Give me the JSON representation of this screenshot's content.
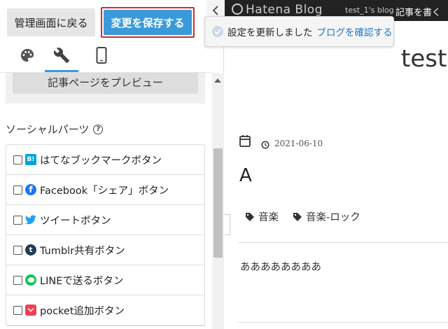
{
  "header": {
    "back_label": "管理画面に戻る",
    "save_label": "変更を保存する"
  },
  "tabs": [
    {
      "icon": "palette-icon"
    },
    {
      "icon": "wrench-icon"
    },
    {
      "icon": "smartphone-icon"
    }
  ],
  "preview_button_label": "記事ページをプレビュー",
  "social": {
    "heading": "ソーシャルパーツ",
    "help_glyph": "?",
    "items": [
      {
        "label": "はてなブックマークボタン",
        "icon": "hatena-bookmark-icon",
        "glyph": "B!",
        "checked": false
      },
      {
        "label": "Facebook「シェア」ボタン",
        "icon": "facebook-icon",
        "glyph": "f",
        "checked": false
      },
      {
        "label": "ツイートボタン",
        "icon": "twitter-icon",
        "glyph": "",
        "checked": false
      },
      {
        "label": "Tumblr共有ボタン",
        "icon": "tumblr-icon",
        "glyph": "t",
        "checked": false
      },
      {
        "label": "LINEで送るボタン",
        "icon": "line-icon",
        "glyph": "",
        "checked": false
      },
      {
        "label": "pocket追加ボタン",
        "icon": "pocket-icon",
        "glyph": "",
        "checked": false
      }
    ]
  },
  "notification": {
    "message": "設定を更新しました",
    "link": "ブログを確認する"
  },
  "blog": {
    "logo_text": "Hatena Blog",
    "blog_name": "test_1's blog",
    "write_label": "記事を書く",
    "title": "test-",
    "entry": {
      "date": "2021-06-10",
      "title": "A",
      "categories": [
        "音楽",
        "音楽-ロック"
      ],
      "body": "ああああああああ"
    }
  },
  "colors": {
    "accent": "#3a9ad9",
    "save_border": "#c9302c",
    "link": "#1e78c8",
    "topbar": "#222222"
  }
}
